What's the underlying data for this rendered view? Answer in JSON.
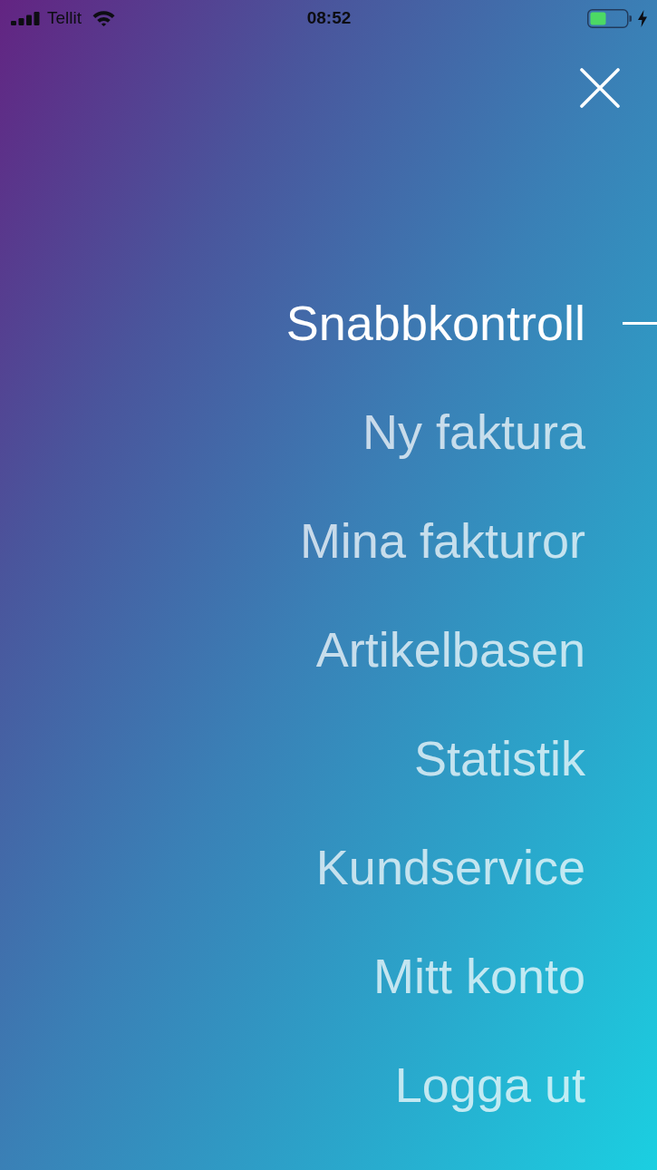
{
  "status_bar": {
    "carrier": "Tellit",
    "time": "08:52"
  },
  "menu": {
    "items": [
      {
        "label": "Snabbkontroll",
        "selected": true
      },
      {
        "label": "Ny faktura",
        "selected": false
      },
      {
        "label": "Mina fakturor",
        "selected": false
      },
      {
        "label": "Artikelbasen",
        "selected": false
      },
      {
        "label": "Statistik",
        "selected": false
      },
      {
        "label": "Kundservice",
        "selected": false
      },
      {
        "label": "Mitt konto",
        "selected": false
      },
      {
        "label": "Logga ut",
        "selected": false
      }
    ]
  }
}
